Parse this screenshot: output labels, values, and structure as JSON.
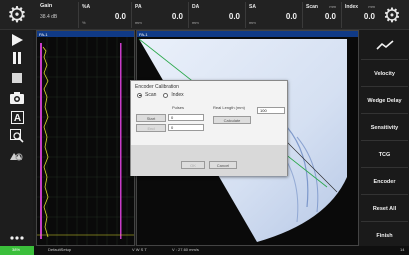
{
  "topbar": {
    "gain_label": "Gain",
    "gain_value": "38.4 dB",
    "measurements": [
      {
        "label": "%A",
        "unit": "%",
        "value": "0.0"
      },
      {
        "label": "PA",
        "unit": "mm",
        "value": "0.0"
      },
      {
        "label": "DA",
        "unit": "mm",
        "value": "0.0"
      },
      {
        "label": "SA",
        "unit": "mm",
        "value": "0.0"
      },
      {
        "label": "Scan",
        "unit": "mm",
        "value": "0.0"
      },
      {
        "label": "Index",
        "unit": "mm",
        "value": "0.0"
      }
    ]
  },
  "panels": {
    "ascan_tag": "PA-1",
    "sscan_tag": "PA-1"
  },
  "rightmenu": {
    "items": [
      "Velocity",
      "Wedge Delay",
      "Sensitivity",
      "TCG",
      "Encoder",
      "Reset All",
      "Finish"
    ]
  },
  "dialog": {
    "title": "Encoder Calibration",
    "radio_scan": "Scan",
    "radio_index": "Index",
    "pulses_label": "Pulses",
    "real_length_label": "Real Length (mm)",
    "start_label": "Start",
    "end_label": "End",
    "start_pulses": "0",
    "end_pulses": "0",
    "real_length_value": "100",
    "calculate_label": "Calculate",
    "ok_label": "OK",
    "cancel_label": "Cancel",
    "selected_axis": "Scan"
  },
  "statusbar": {
    "battery": "38%",
    "setup": "DefaultSetup",
    "flags": "V  W  S  T",
    "velocity": "V : 27.60 mm/s",
    "right": "14"
  },
  "colors": {
    "accent_blue": "#103a86",
    "sscan_beam": "#dfe8f6",
    "battery_green": "#3bbf3b",
    "ascan_trace": "#d8d82a",
    "gate_magenta": "#c83cc8",
    "angle_line": "#2aa84a"
  },
  "icons": [
    "gear-icon",
    "play-icon",
    "pause-icon",
    "stop-icon",
    "camera-icon",
    "text-a-icon",
    "zoom-icon",
    "image-zoom-icon",
    "more-icon",
    "settings-icon",
    "trend-icon"
  ]
}
